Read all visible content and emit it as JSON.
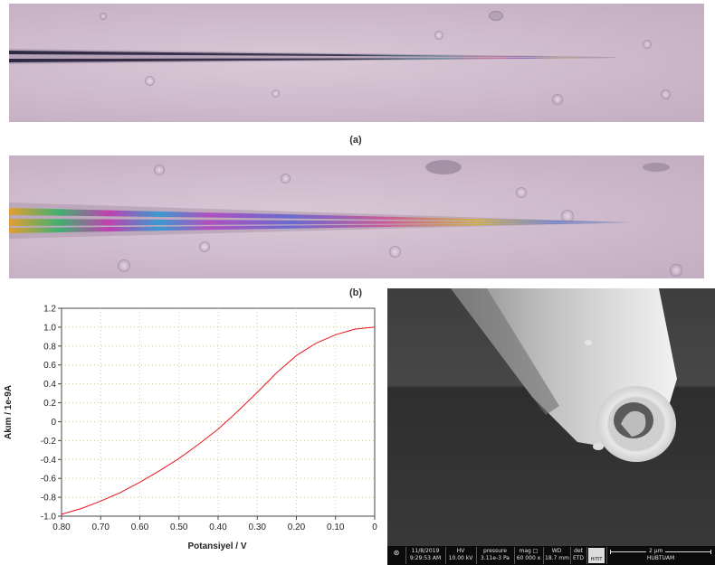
{
  "figure": {
    "caption_a": "(a)",
    "caption_b": "(b)"
  },
  "chart_data": {
    "type": "line",
    "xlabel": "Potansiyel / V",
    "ylabel": "Akım / 1e-9A",
    "xlim": [
      0.8,
      0
    ],
    "ylim": [
      -1.0,
      1.2
    ],
    "x_ticks": [
      "0.80",
      "0.70",
      "0.60",
      "0.50",
      "0.40",
      "0.30",
      "0.20",
      "0.10",
      "0"
    ],
    "y_ticks": [
      "1.2",
      "1.0",
      "0.8",
      "0.6",
      "0.4",
      "0.2",
      "0",
      "-0.2",
      "-0.4",
      "-0.6",
      "-0.8",
      "-1.0"
    ],
    "grid": true,
    "series": [
      {
        "color": "#e8141c",
        "x": [
          0.8,
          0.75,
          0.7,
          0.65,
          0.6,
          0.55,
          0.5,
          0.45,
          0.4,
          0.35,
          0.3,
          0.25,
          0.2,
          0.15,
          0.1,
          0.05,
          0.0
        ],
        "y": [
          -0.98,
          -0.92,
          -0.84,
          -0.75,
          -0.64,
          -0.52,
          -0.39,
          -0.24,
          -0.08,
          0.11,
          0.31,
          0.52,
          0.7,
          0.83,
          0.92,
          0.98,
          1.0
        ]
      }
    ]
  },
  "sem": {
    "date": "11/8/2019",
    "time": "9:29:53 AM",
    "hv_label": "HV",
    "hv": "10.00 kV",
    "pressure_label": "pressure",
    "pressure": "3.11e-3 Pa",
    "mag_label": "mag",
    "mag": "60 000 x",
    "wd_label": "WD",
    "wd": "18.7 mm",
    "det_label": "det",
    "det": "ETD",
    "logo_text": "HITIT",
    "scale": "2 µm",
    "lab": "HUBTUAM"
  }
}
